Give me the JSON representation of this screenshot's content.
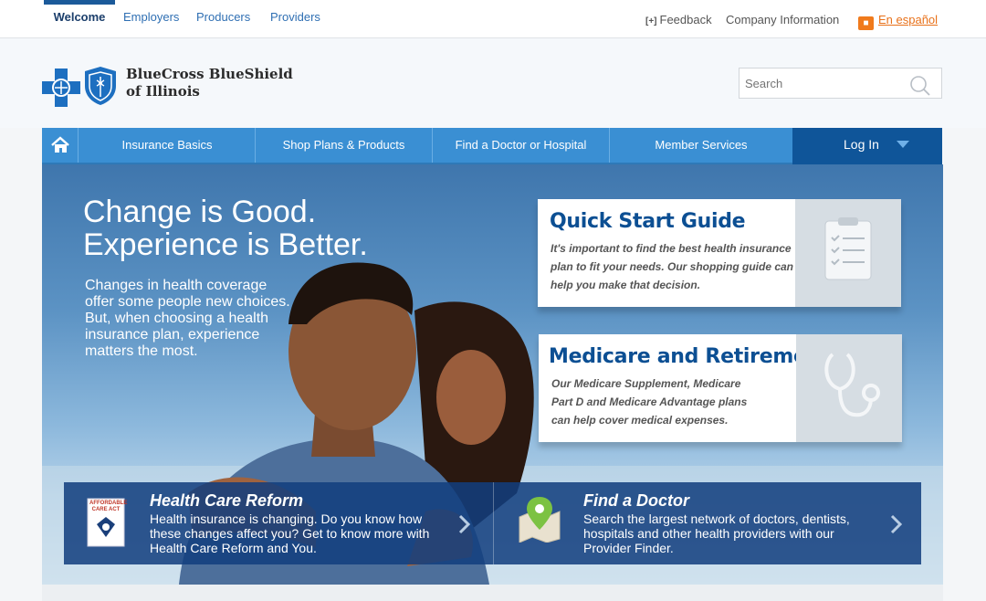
{
  "top_tabs": [
    "Welcome",
    "Employers",
    "Producers",
    "Providers"
  ],
  "utility": {
    "feedback_icon": "[+]",
    "feedback": "Feedback",
    "company": "Company Information",
    "spanish": "En español"
  },
  "brand": {
    "line1": "BlueCross BlueShield",
    "line2": "of Illinois"
  },
  "search": {
    "placeholder": "Search"
  },
  "nav": {
    "items": [
      "Insurance Basics",
      "Shop Plans & Products",
      "Find a Doctor or Hospital",
      "Member Services"
    ],
    "login": "Log In"
  },
  "hero": {
    "headline_line1": "Change is Good.",
    "headline_line2": "Experience is Better.",
    "subcopy": "Changes in health coverage offer some people new choices. But, when choosing a health insurance plan, experience matters the most."
  },
  "cards": [
    {
      "title": "Quick Start Guide",
      "lines": [
        "It's important to find the best health insurance",
        "plan to fit your needs. Our shopping guide can",
        "help you make that decision."
      ]
    },
    {
      "title": "Medicare and Retirement",
      "lines": [
        "Our Medicare Supplement, Medicare",
        "Part D and Medicare Advantage plans",
        "can help cover medical expenses."
      ]
    }
  ],
  "promos": [
    {
      "title": "Health Care Reform",
      "lines": [
        "Health insurance is changing. Do you know how",
        "these changes affect you? Get to know more with",
        "Health Care Reform and You."
      ],
      "badge": "AFFORDABLE CARE ACT"
    },
    {
      "title": "Find a Doctor",
      "lines": [
        "Search the largest network of doctors, dentists,",
        "hospitals and other health providers with our",
        "Provider Finder."
      ]
    }
  ],
  "colors": {
    "nav_blue": "#3a8fd3",
    "login_blue": "#0f5599",
    "title_blue": "#0c4f93",
    "accent_orange": "#f07a1c"
  }
}
